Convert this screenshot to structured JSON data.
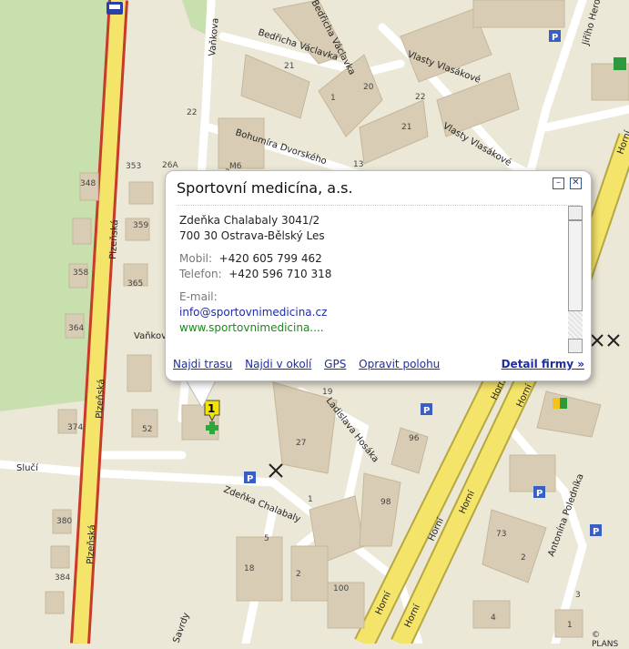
{
  "popup": {
    "title": "Sportovní medicína, a.s.",
    "minimize_label": "–",
    "close_label": "✕",
    "address_line1": "Zdeňka Chalabaly 3041/2",
    "address_line2": "700 30 Ostrava-Bělský Les",
    "mobile_label": "Mobil:",
    "mobile_value": "+420 605 799 462",
    "phone_label": "Telefon:",
    "phone_value": "+420 596 710 318",
    "email_label": "E-mail:",
    "email_value": "info@sportovnimedicina.cz",
    "web_value": "www.sportovnimedicina....",
    "links": [
      "Najdi trasu",
      "Najdi v okolí",
      "GPS",
      "Opravit polohu"
    ],
    "detail_label": "Detail firmy »"
  },
  "marker_number": "1",
  "copyright": "© PLANS",
  "streets": {
    "plzenska": "Plzeňská",
    "vankova": "Vaňkova",
    "bedricha_vaclavka": "Bedřicha Václavka",
    "bohumira_dvorskeho": "Bohumíra Dvorského",
    "vlasty_vlasakove": "Vlasty Vlasákové",
    "jiriho_herolda": "Jiřího Herolda",
    "horni": "Horní",
    "ladislava_hosaka": "Ladislava Hosáka",
    "zdenka_chalabaly": "Zdeňka Chalabaly",
    "sluci": "Slučí",
    "antonina_polednika": "Antonína Poledníka",
    "savrdy": "Savrdy"
  },
  "house_numbers": [
    "348",
    "353",
    "359",
    "358",
    "365",
    "364",
    "374",
    "380",
    "384",
    "26A",
    "22",
    "21",
    "1",
    "13",
    "3",
    "20",
    "22",
    "21",
    "19",
    "27",
    "1",
    "52",
    "96",
    "98",
    "73",
    "2",
    "5",
    "18",
    "2",
    "100",
    "4",
    "3",
    "1",
    "M6"
  ],
  "icons": [
    "bus-stop-icon",
    "parking-icon",
    "fuel-station-icon",
    "restaurant-icon",
    "medical-cross-icon"
  ]
}
